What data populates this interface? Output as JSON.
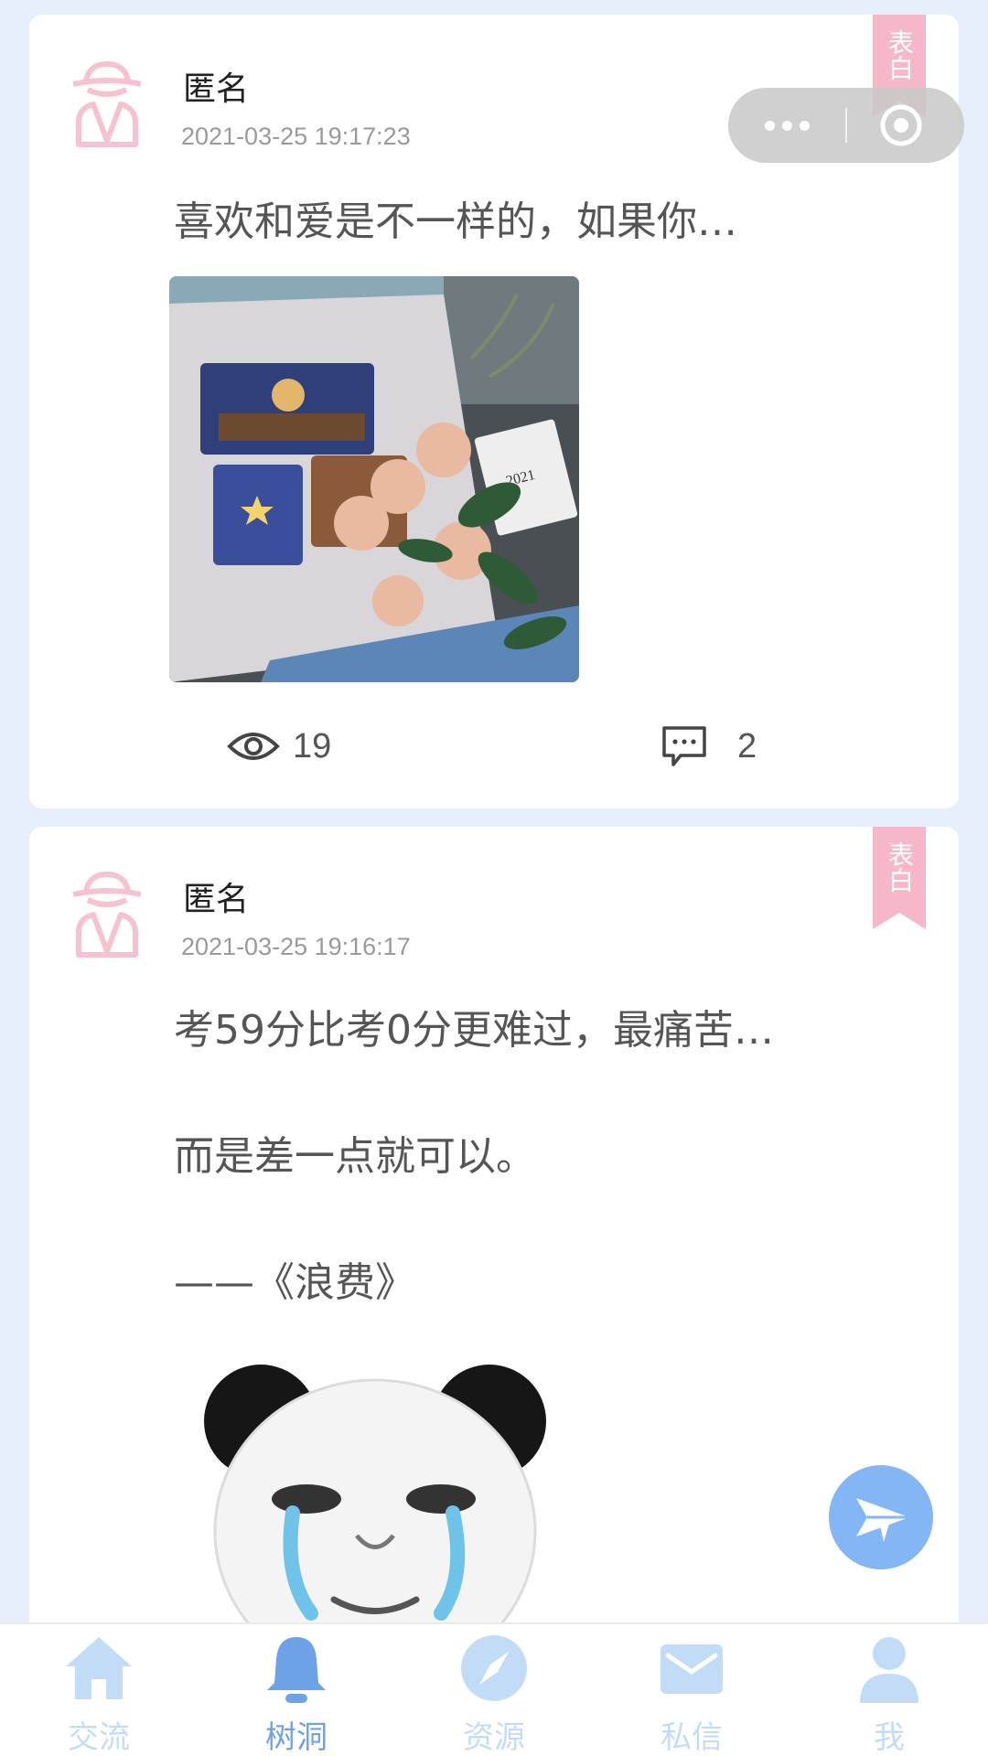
{
  "colors": {
    "background": "#e8effc",
    "ribbon": "#f6b8c8",
    "avatar": "#f5c2cf",
    "tab_inactive": "#c2dcf8",
    "tab_active": "#6ea2e6",
    "fab": "#84b6f6"
  },
  "posts": [
    {
      "author": "匿名",
      "timestamp": "2021-03-25 19:17:23",
      "tag": "表白",
      "text_lines": [
        "喜欢和爱是不一样的，如果你…"
      ],
      "image": "photo-book-and-roses",
      "views": "19",
      "comments": "2"
    },
    {
      "author": "匿名",
      "timestamp": "2021-03-25 19:16:17",
      "tag": "表白",
      "text_lines": [
        "考59分比考0分更难过，最痛苦…",
        "而是差一点就可以。",
        "——《浪费》"
      ],
      "image": "crying-panda-meme"
    }
  ],
  "icons": {
    "avatar": "anonymous-spy-icon",
    "views": "eye-icon",
    "comments": "comment-bubble-icon",
    "fab": "paper-plane-icon",
    "capsule_more": "more-dots-icon",
    "capsule_close": "target-circle-icon"
  },
  "tabbar": {
    "items": [
      {
        "label": "交流",
        "icon": "home-icon",
        "active": false
      },
      {
        "label": "树洞",
        "icon": "bell-icon",
        "active": true
      },
      {
        "label": "资源",
        "icon": "compass-icon",
        "active": false
      },
      {
        "label": "私信",
        "icon": "mail-icon",
        "active": false
      },
      {
        "label": "我",
        "icon": "user-icon",
        "active": false
      }
    ]
  }
}
